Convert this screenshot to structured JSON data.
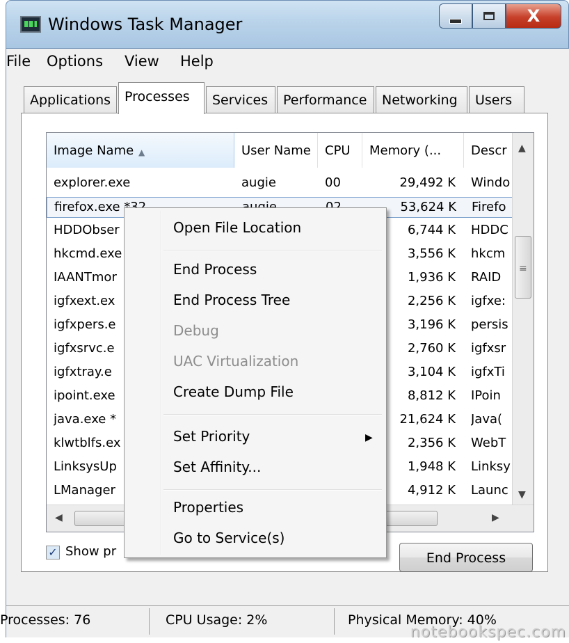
{
  "window": {
    "title": "Windows Task Manager",
    "close_glyph": "X"
  },
  "menu": [
    "File",
    "Options",
    "View",
    "Help"
  ],
  "tabs": [
    "Applications",
    "Processes",
    "Services",
    "Performance",
    "Networking",
    "Users"
  ],
  "columns": [
    "Image Name",
    "User Name",
    "CPU",
    "Memory (...",
    "Descr"
  ],
  "rows": [
    {
      "name": "explorer.exe",
      "user": "augie",
      "cpu": "00",
      "mem": "29,492 K",
      "desc": "Windo"
    },
    {
      "name": "firefox.exe *32",
      "user": "augie",
      "cpu": "02",
      "mem": "53,624 K",
      "desc": "Firefo"
    },
    {
      "name": "HDDObser",
      "user": "",
      "cpu": "",
      "mem": "6,744 K",
      "desc": "HDDC"
    },
    {
      "name": "hkcmd.exe",
      "user": "",
      "cpu": "",
      "mem": "3,556 K",
      "desc": "hkcm"
    },
    {
      "name": "IAANTmor",
      "user": "",
      "cpu": "",
      "mem": "1,936 K",
      "desc": "RAID"
    },
    {
      "name": "igfxext.ex",
      "user": "",
      "cpu": "",
      "mem": "2,256 K",
      "desc": "igfxe:"
    },
    {
      "name": "igfxpers.e",
      "user": "",
      "cpu": "",
      "mem": "3,196 K",
      "desc": "persis"
    },
    {
      "name": "igfxsrvc.e",
      "user": "",
      "cpu": "",
      "mem": "2,760 K",
      "desc": "igfxsr"
    },
    {
      "name": "igfxtray.e",
      "user": "",
      "cpu": "",
      "mem": "3,104 K",
      "desc": "igfxTi"
    },
    {
      "name": "ipoint.exe",
      "user": "",
      "cpu": "",
      "mem": "8,812 K",
      "desc": "IPoin"
    },
    {
      "name": "java.exe *",
      "user": "",
      "cpu": "",
      "mem": "21,624 K",
      "desc": "Java("
    },
    {
      "name": "klwtblfs.ex",
      "user": "",
      "cpu": "",
      "mem": "2,356 K",
      "desc": "WebT"
    },
    {
      "name": "LinksysUp",
      "user": "",
      "cpu": "",
      "mem": "1,948 K",
      "desc": "Linksy"
    },
    {
      "name": "LManager",
      "user": "",
      "cpu": "",
      "mem": "4,912 K",
      "desc": "Launc"
    }
  ],
  "show_processes_label": "Show pr",
  "end_process_button": "End Process",
  "context_menu": {
    "items": [
      {
        "label": "Open File Location",
        "enabled": true
      },
      {
        "label": "End Process",
        "enabled": true
      },
      {
        "label": "End Process Tree",
        "enabled": true
      },
      {
        "label": "Debug",
        "enabled": false
      },
      {
        "label": "UAC Virtualization",
        "enabled": false
      },
      {
        "label": "Create Dump File",
        "enabled": true
      },
      {
        "label": "Set Priority",
        "enabled": true,
        "submenu": true
      },
      {
        "label": "Set Affinity...",
        "enabled": true
      },
      {
        "label": "Properties",
        "enabled": true
      },
      {
        "label": "Go to Service(s)",
        "enabled": true
      }
    ]
  },
  "status": {
    "processes": "Processes: 76",
    "cpu": "CPU Usage: 2%",
    "memory": "Physical Memory: 40%"
  },
  "watermark": "notebookspec.com",
  "icons": {
    "app": "task-manager-icon",
    "submenu": "triangle-right",
    "sort": "triangle-up",
    "check": "check-mark"
  }
}
